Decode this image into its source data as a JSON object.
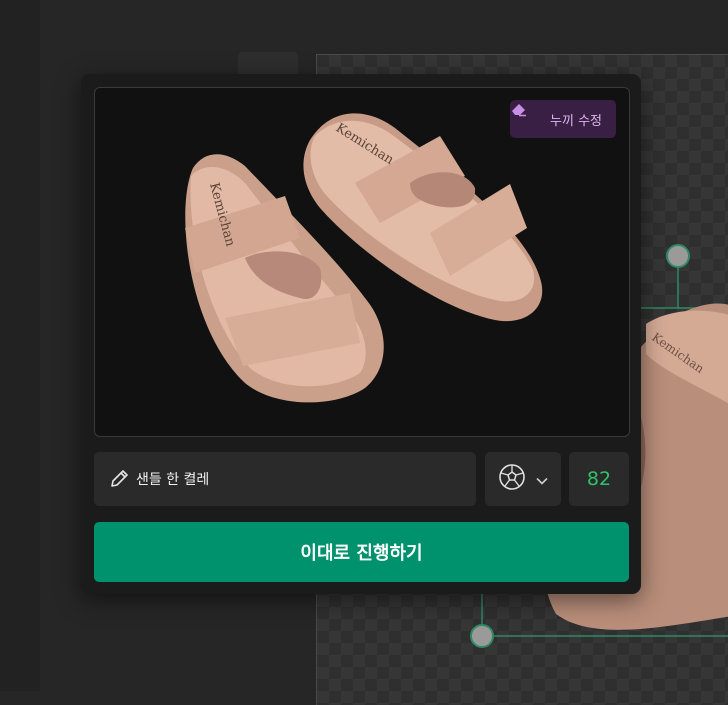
{
  "image_editor": {
    "edit_mask_label": "누끼 수정",
    "prompt_value": "샌들 한 켤레",
    "score": "82",
    "proceed_label": "이대로 진행하기",
    "category_icon": "soccer-ball-icon",
    "shoe_brand_text": "Kemichan"
  },
  "colors": {
    "accent_green": "#00916d",
    "score_green": "#2ec36a",
    "mask_button_bg": "#3a1f45",
    "mask_button_text": "#dcb5ee"
  }
}
